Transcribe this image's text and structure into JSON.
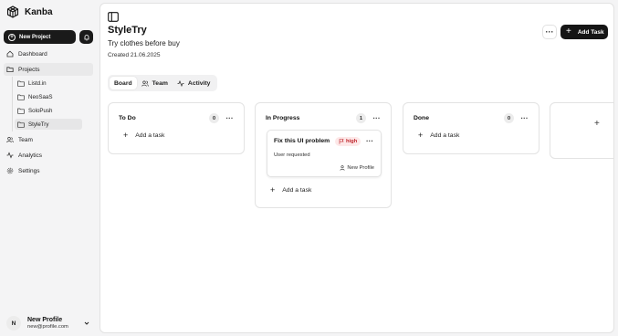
{
  "sidebar": {
    "brand": "Kanba",
    "new_project_label": "New Project",
    "nav": [
      {
        "label": "Dashboard",
        "icon": "home-icon"
      },
      {
        "label": "Projects",
        "icon": "folder-icon"
      },
      {
        "label": "Team",
        "icon": "users-icon"
      },
      {
        "label": "Analytics",
        "icon": "activity-icon"
      },
      {
        "label": "Settings",
        "icon": "gear-icon"
      }
    ],
    "projects": [
      "Listd.in",
      "NeoSaaS",
      "SoloPush",
      "StyleTry"
    ],
    "active_project": "StyleTry",
    "profile": {
      "initial": "N",
      "name": "New Profile",
      "email": "new@profile.com"
    }
  },
  "project": {
    "title": "StyleTry",
    "subtitle": "Try clothes before buy",
    "created": "Created 21.06.2025",
    "more_label": "···",
    "add_task_label": "Add Task"
  },
  "tabs": [
    {
      "label": "Board",
      "active": true
    },
    {
      "label": "Team",
      "active": false
    },
    {
      "label": "Activity",
      "active": false
    }
  ],
  "columns": [
    {
      "title": "To Do",
      "count": "0",
      "add_label": "Add a task"
    },
    {
      "title": "In Progress",
      "count": "1",
      "add_label": "Add a task",
      "tasks": [
        {
          "title": "Fix this UI problem",
          "priority": "high",
          "description": "User requested",
          "assignee": "New Profile"
        }
      ]
    },
    {
      "title": "Done",
      "count": "0",
      "add_label": "Add a task"
    }
  ],
  "colors": {
    "primary": "#151515",
    "priority_high_bg": "#fde8e8",
    "priority_high_text": "#c0262d",
    "active_bg": "#e9e9ea"
  }
}
